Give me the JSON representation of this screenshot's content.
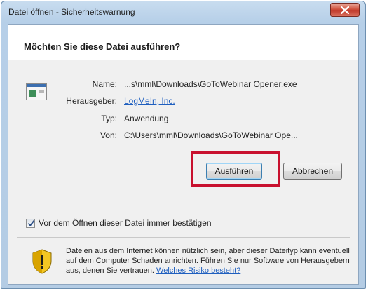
{
  "window": {
    "title": "Datei öffnen - Sicherheitswarnung"
  },
  "dialog": {
    "question": "Möchten Sie diese Datei ausführen?",
    "fields": {
      "name_label": "Name:",
      "name_value": "...s\\mml\\Downloads\\GoToWebinar Opener.exe",
      "publisher_label": "Herausgeber:",
      "publisher_value": "LogMeIn, Inc.",
      "type_label": "Typ:",
      "type_value": "Anwendung",
      "from_label": "Von:",
      "from_value": "C:\\Users\\mml\\Downloads\\GoToWebinar Ope..."
    },
    "buttons": {
      "run": "Ausführen",
      "cancel": "Abbrechen"
    },
    "checkbox": {
      "label": "Vor dem Öffnen dieser Datei immer bestätigen",
      "checked": true
    },
    "warning": {
      "text": "Dateien aus dem Internet können nützlich sein, aber dieser Dateityp kann eventuell auf dem Computer Schaden anrichten. Führen Sie nur Software von Herausgebern aus, denen Sie vertrauen. ",
      "link": "Welches Risiko besteht?"
    }
  },
  "colors": {
    "highlight": "#c8102e",
    "link": "#1f5fbf",
    "close_button": "#c0392b"
  }
}
